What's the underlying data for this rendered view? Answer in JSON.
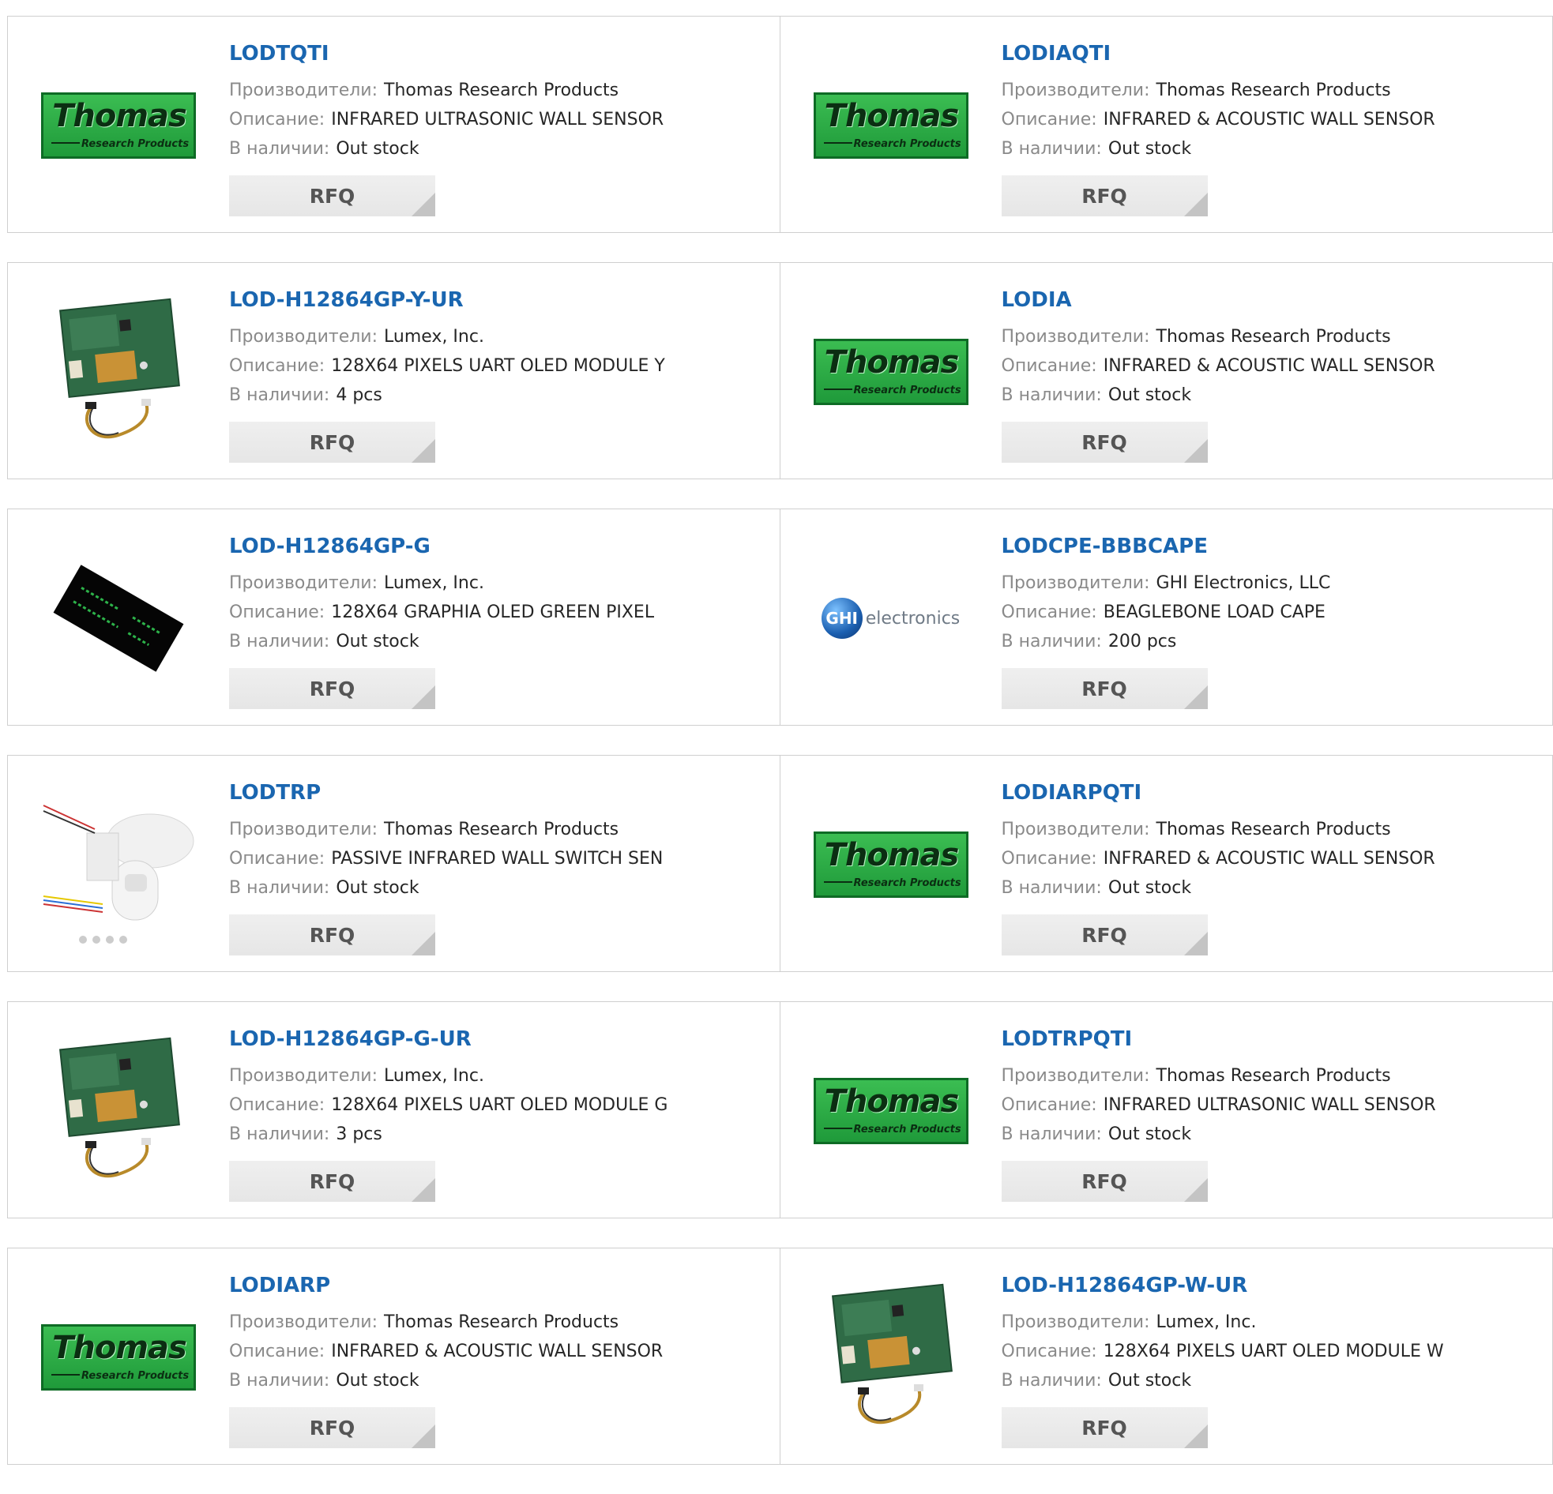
{
  "labels": {
    "manufacturer": "Производители:",
    "description": "Описание:",
    "stock": "В наличии:",
    "rfq": "RFQ"
  },
  "logos": {
    "thomas_big": "Thomas",
    "thomas_small": "Research Products",
    "ghi_mark": "GHI",
    "ghi_text": "electronics"
  },
  "colors": {
    "link": "#1a66b0",
    "thomas_green": "#2aa844"
  },
  "products": [
    {
      "part": "LODTQTI",
      "manufacturer": "Thomas Research Products",
      "description": "INFRARED ULTRASONIC WALL SENSOR",
      "stock": "Out stock",
      "image": "thomas-logo"
    },
    {
      "part": "LODIAQTI",
      "manufacturer": "Thomas Research Products",
      "description": "INFRARED & ACOUSTIC WALL SENSOR",
      "stock": "Out stock",
      "image": "thomas-logo"
    },
    {
      "part": "LOD-H12864GP-Y-UR",
      "manufacturer": "Lumex, Inc.",
      "description": "128X64 PIXELS UART OLED MODULE Y",
      "stock": "4 pcs",
      "image": "oled-module-board"
    },
    {
      "part": "LODIA",
      "manufacturer": "Thomas Research Products",
      "description": "INFRARED & ACOUSTIC WALL SENSOR",
      "stock": "Out stock",
      "image": "thomas-logo"
    },
    {
      "part": "LOD-H12864GP-G",
      "manufacturer": "Lumex, Inc.",
      "description": "128X64 GRAPHIA OLED GREEN PIXEL",
      "stock": "Out stock",
      "image": "oled-display-panel"
    },
    {
      "part": "LODCPE-BBBCAPE",
      "manufacturer": "GHI Electronics, LLC",
      "description": "BEAGLEBONE LOAD CAPE",
      "stock": "200 pcs",
      "image": "ghi-logo"
    },
    {
      "part": "LODTRP",
      "manufacturer": "Thomas Research Products",
      "description": "PASSIVE INFRARED WALL SWITCH SEN",
      "stock": "Out stock",
      "image": "sensor-kit"
    },
    {
      "part": "LODIARPQTI",
      "manufacturer": "Thomas Research Products",
      "description": "INFRARED & ACOUSTIC WALL SENSOR",
      "stock": "Out stock",
      "image": "thomas-logo"
    },
    {
      "part": "LOD-H12864GP-G-UR",
      "manufacturer": "Lumex, Inc.",
      "description": "128X64 PIXELS UART OLED MODULE G",
      "stock": "3 pcs",
      "image": "oled-module-board"
    },
    {
      "part": "LODTRPQTI",
      "manufacturer": "Thomas Research Products",
      "description": "INFRARED ULTRASONIC WALL SENSOR",
      "stock": "Out stock",
      "image": "thomas-logo"
    },
    {
      "part": "LODIARP",
      "manufacturer": "Thomas Research Products",
      "description": "INFRARED & ACOUSTIC WALL SENSOR",
      "stock": "Out stock",
      "image": "thomas-logo"
    },
    {
      "part": "LOD-H12864GP-W-UR",
      "manufacturer": "Lumex, Inc.",
      "description": "128X64 PIXELS UART OLED MODULE W",
      "stock": "Out stock",
      "image": "oled-module-board"
    }
  ]
}
